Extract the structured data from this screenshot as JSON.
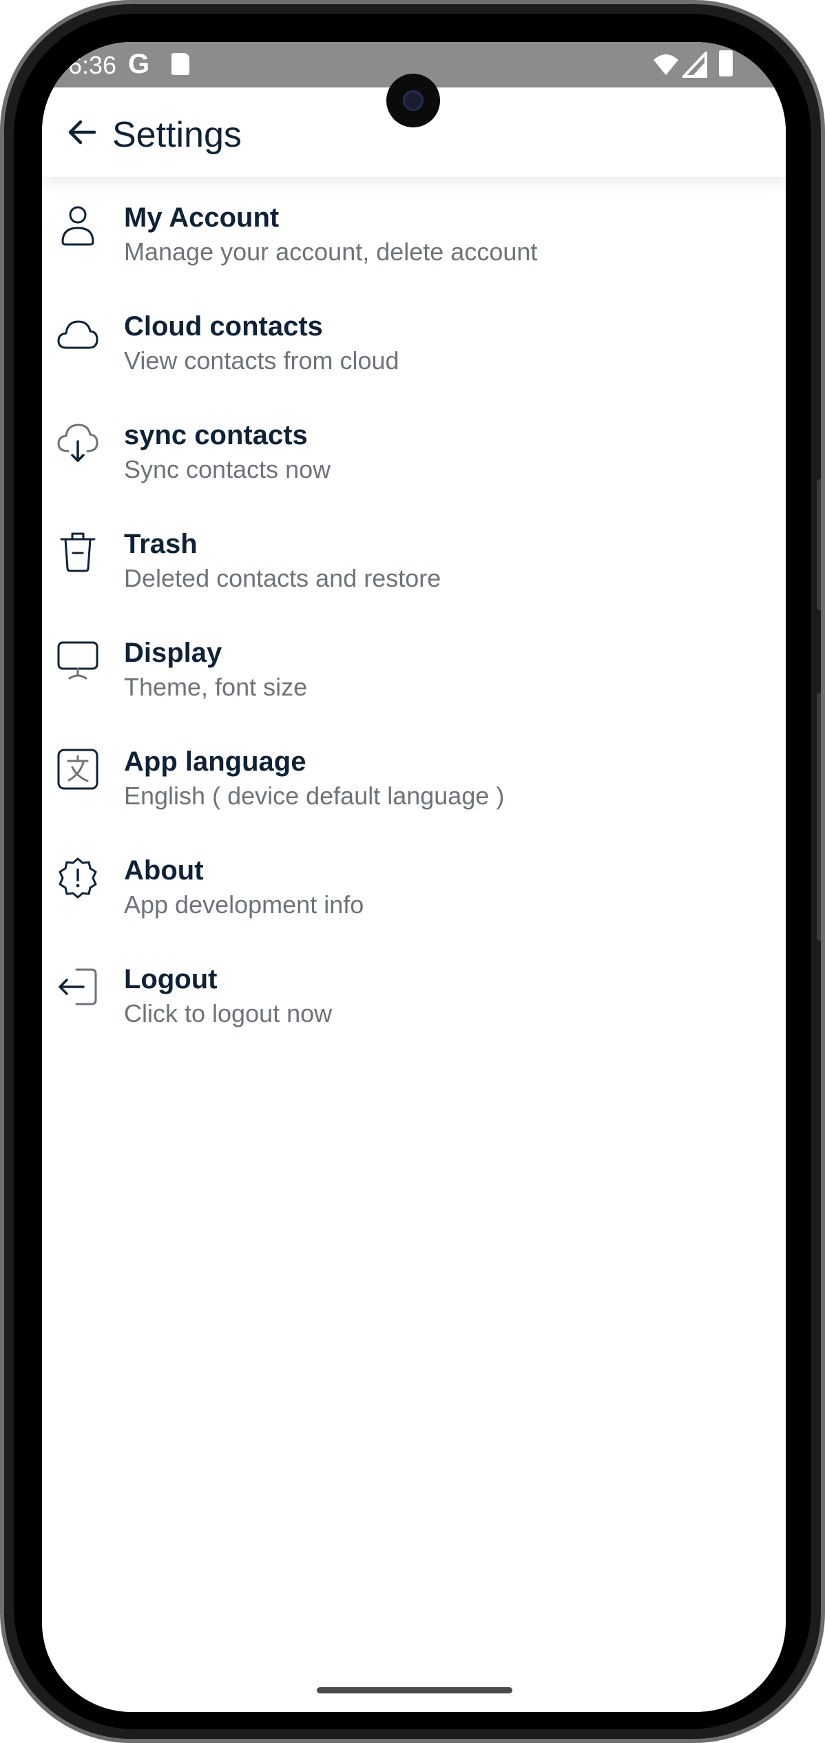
{
  "status_bar": {
    "time": "6:36",
    "g_label": "G"
  },
  "header": {
    "title": "Settings",
    "back_icon": "arrow-left-icon"
  },
  "settings_items": [
    {
      "icon": "user-icon",
      "title": "My Account",
      "subtitle": "Manage your account, delete account"
    },
    {
      "icon": "cloud-icon",
      "title": "Cloud contacts",
      "subtitle": "View contacts from cloud"
    },
    {
      "icon": "cloud-download-icon",
      "title": "sync contacts",
      "subtitle": "Sync contacts now"
    },
    {
      "icon": "trash-icon",
      "title": "Trash",
      "subtitle": "Deleted contacts and restore"
    },
    {
      "icon": "monitor-icon",
      "title": "Display",
      "subtitle": "Theme, font size"
    },
    {
      "icon": "language-icon",
      "title": "App language",
      "subtitle": "English ( device default language )"
    },
    {
      "icon": "info-badge-icon",
      "title": "About",
      "subtitle": "App development info"
    },
    {
      "icon": "logout-icon",
      "title": "Logout",
      "subtitle": "Click to logout now"
    }
  ],
  "colors": {
    "title_text": "#0f2236",
    "subtitle_text": "#6e737a",
    "status_bar_bg": "#8b8c8e",
    "background": "#ffffff"
  }
}
